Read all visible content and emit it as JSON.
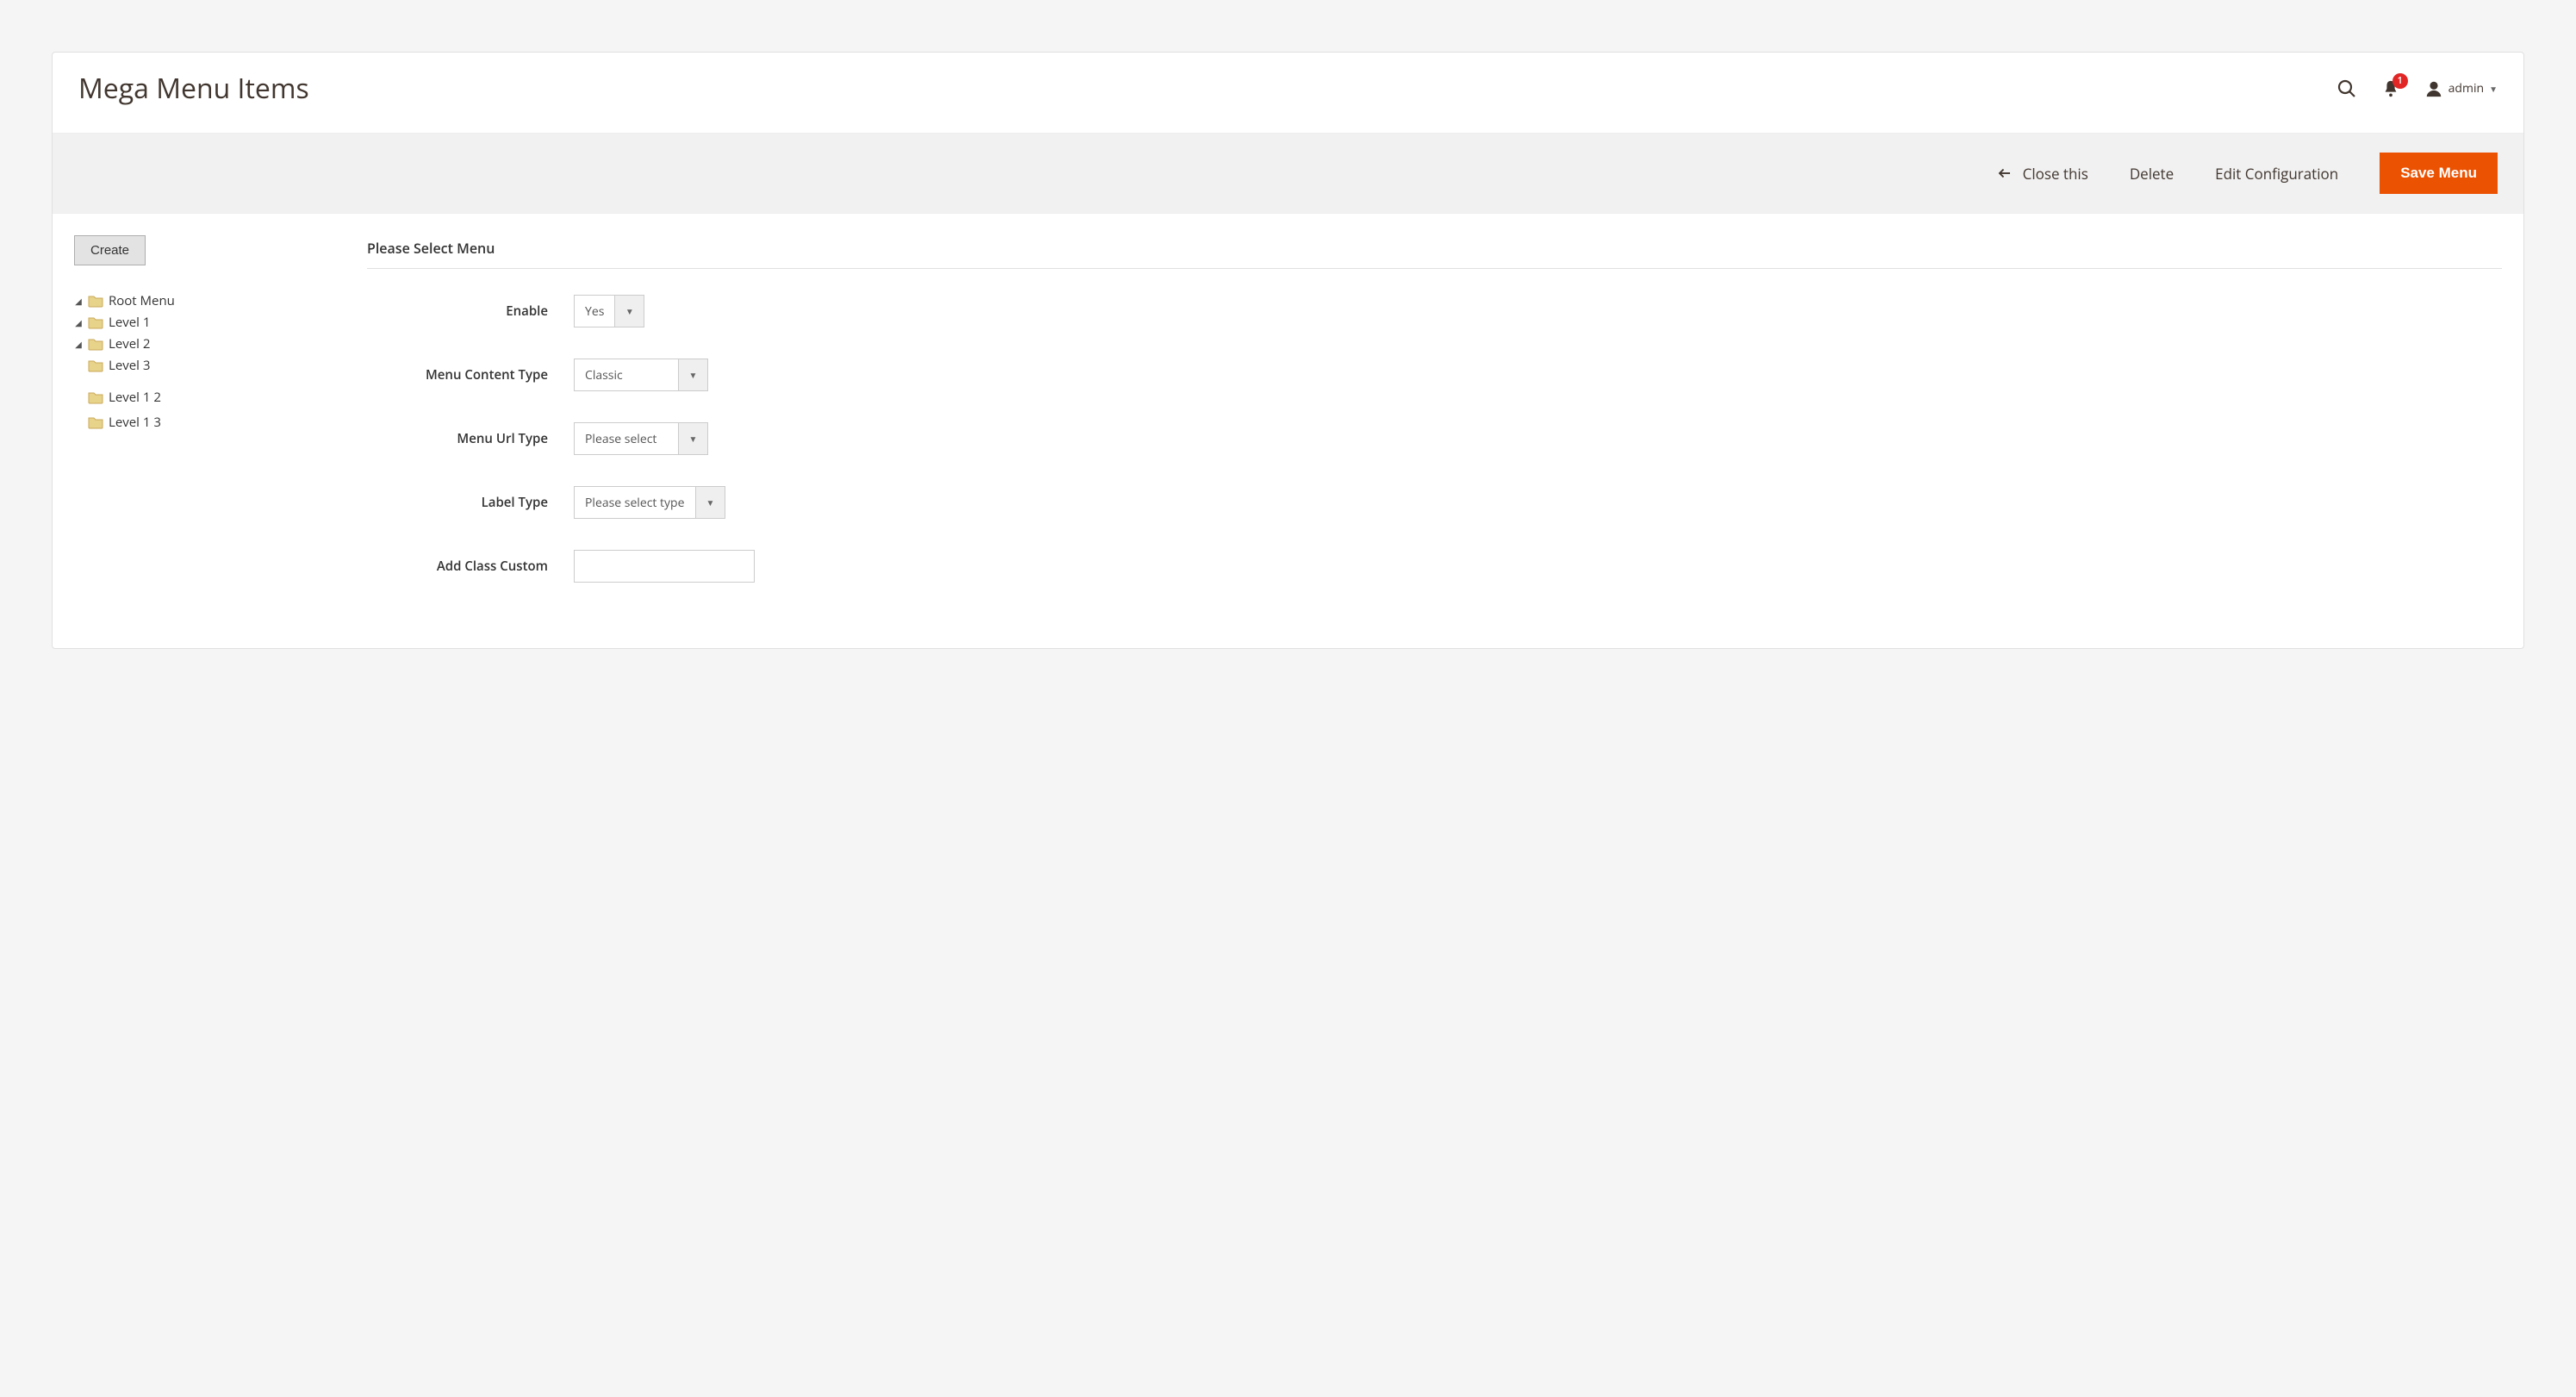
{
  "page": {
    "title": "Mega Menu Items"
  },
  "header": {
    "notification_count": "1",
    "admin_label": "admin"
  },
  "toolbar": {
    "close": "Close this",
    "delete": "Delete",
    "edit_config": "Edit Configuration",
    "save": "Save Menu"
  },
  "sidebar": {
    "create": "Create",
    "tree": {
      "root": "Root Menu",
      "l1": "Level 1",
      "l2": "Level 2",
      "l3": "Level 3",
      "l1_2": "Level 1 2",
      "l1_3": "Level 1 3"
    }
  },
  "form": {
    "section_title": "Please Select Menu",
    "fields": {
      "enable": {
        "label": "Enable",
        "value": "Yes"
      },
      "content_type": {
        "label": "Menu Content Type",
        "value": "Classic"
      },
      "url_type": {
        "label": "Menu Url Type",
        "value": "Please select"
      },
      "label_type": {
        "label": "Label Type",
        "value": "Please select type"
      },
      "add_class": {
        "label": "Add Class Custom",
        "value": ""
      }
    }
  }
}
